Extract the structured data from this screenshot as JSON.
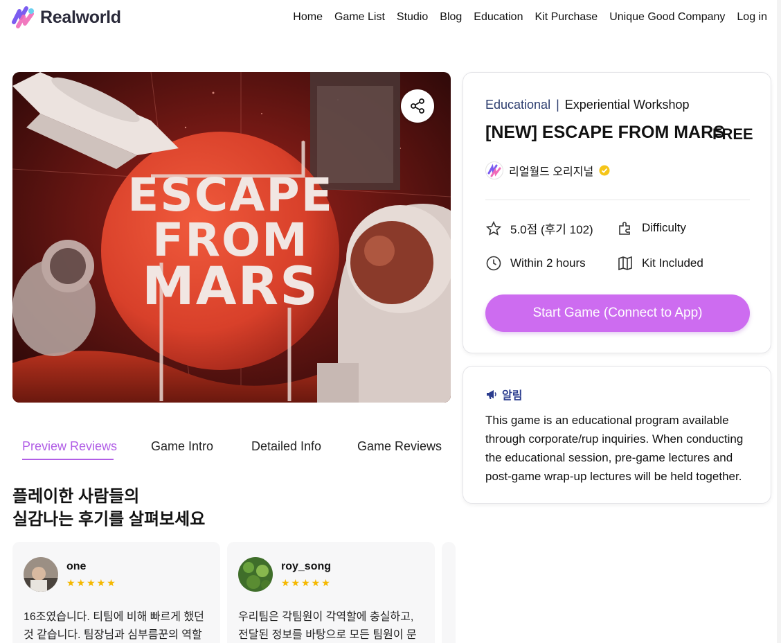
{
  "header": {
    "brand": "Realworld",
    "nav": [
      "Home",
      "Game List",
      "Studio",
      "Blog",
      "Education",
      "Kit Purchase",
      "Unique Good Company",
      "Log in"
    ]
  },
  "hero": {
    "poster_lines": [
      "ESCAPE",
      "FROM",
      "MARS"
    ],
    "share_icon": "share-icon"
  },
  "tabs": [
    "Preview Reviews",
    "Game Intro",
    "Detailed Info",
    "Game Reviews"
  ],
  "active_tab": "Preview Reviews",
  "reviews": {
    "heading_line1": "플레이한 사람들의",
    "heading_line2": "실감나는 후기를 살펴보세요",
    "items": [
      {
        "name": "one",
        "stars": "★★★★★",
        "text": "16조였습니다. 티팀에 비해 빠르게 했던 것 같습니다. 팀장님과 심부름꾼의 역할"
      },
      {
        "name": "roy_song",
        "stars": "★★★★★",
        "text": "우리팀은 각팀원이 각역할에 충실하고, 전달된 정보를 바탕으로 모든 팀원이 문"
      }
    ]
  },
  "game": {
    "category": "Educational",
    "separator": "|",
    "subcategory": "Experiential Workshop",
    "title": "[NEW] ESCAPE FROM MARS",
    "price": "FREE",
    "author": "리얼월드 오리지널",
    "rating": "5.0점 (후기 102)",
    "difficulty": "Difficulty",
    "duration": "Within 2 hours",
    "kit": "Kit Included",
    "start_button": "Start Game (Connect to App)"
  },
  "notice": {
    "title": "알림",
    "text": "This game is an educational program available through corporate/rup inquiries. When conducting the educational session, pre-game lectures and post-game wrap-up lectures will be held together."
  },
  "colors": {
    "accent": "#b15ee6",
    "button": "#cd6cf0",
    "navy": "#2b3c6e",
    "star": "#f5b800"
  }
}
